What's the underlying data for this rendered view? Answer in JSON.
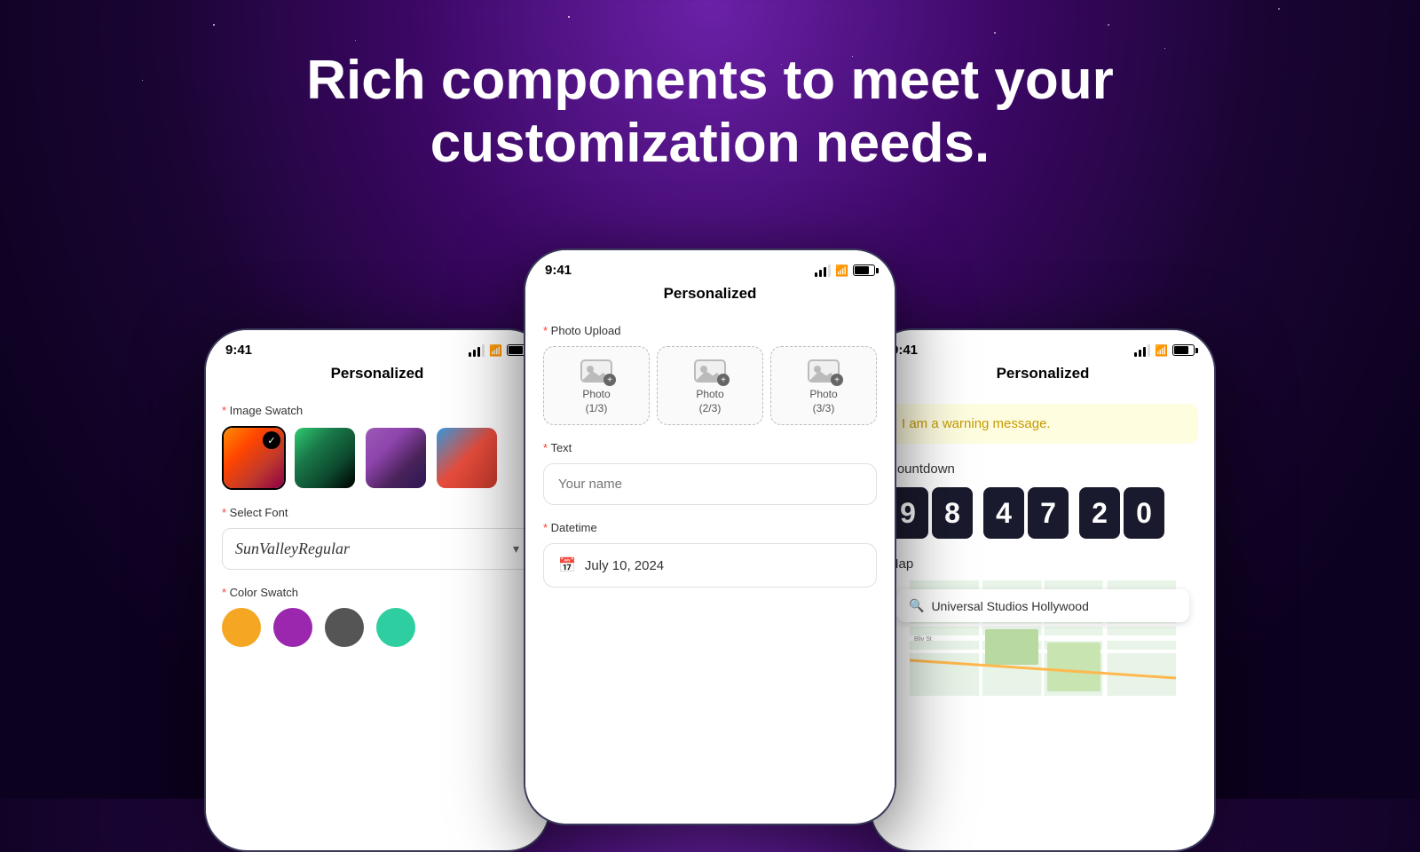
{
  "headline": {
    "line1": "Rich components to meet  your",
    "line2": "customization needs."
  },
  "phones": {
    "left": {
      "time": "9:41",
      "title": "Personalized",
      "sections": {
        "imageSwatch": {
          "label": "Image Swatch",
          "swatches": [
            {
              "id": "orange",
              "selected": true
            },
            {
              "id": "green",
              "selected": false
            },
            {
              "id": "purple",
              "selected": false
            },
            {
              "id": "blue-red",
              "selected": false
            }
          ]
        },
        "selectFont": {
          "label": "Select Font",
          "value": "SunValleyRegular"
        },
        "colorSwatch": {
          "label": "Color Swatch",
          "colors": [
            "#f5a623",
            "#9b27af",
            "#555555",
            "#2ecea0"
          ]
        }
      }
    },
    "center": {
      "time": "9:41",
      "title": "Personalized",
      "sections": {
        "photoUpload": {
          "label": "Photo Upload",
          "slots": [
            {
              "label": "Photo",
              "sublabel": "(1/3)"
            },
            {
              "label": "Photo",
              "sublabel": "(2/3)"
            },
            {
              "label": "Photo",
              "sublabel": "(3/3)"
            }
          ]
        },
        "text": {
          "label": "Text",
          "placeholder": "Your name"
        },
        "datetime": {
          "label": "Datetime",
          "value": "July 10, 2024"
        }
      }
    },
    "right": {
      "time": "9:41",
      "title": "Personalized",
      "sections": {
        "warning": {
          "text": "I am a warning message."
        },
        "countdown": {
          "label": "Countdown",
          "digits": [
            "9",
            "8",
            "4",
            "7",
            "2",
            "0"
          ]
        },
        "map": {
          "label": "Map",
          "searchValue": "Universal Studios Hollywood"
        }
      }
    }
  }
}
